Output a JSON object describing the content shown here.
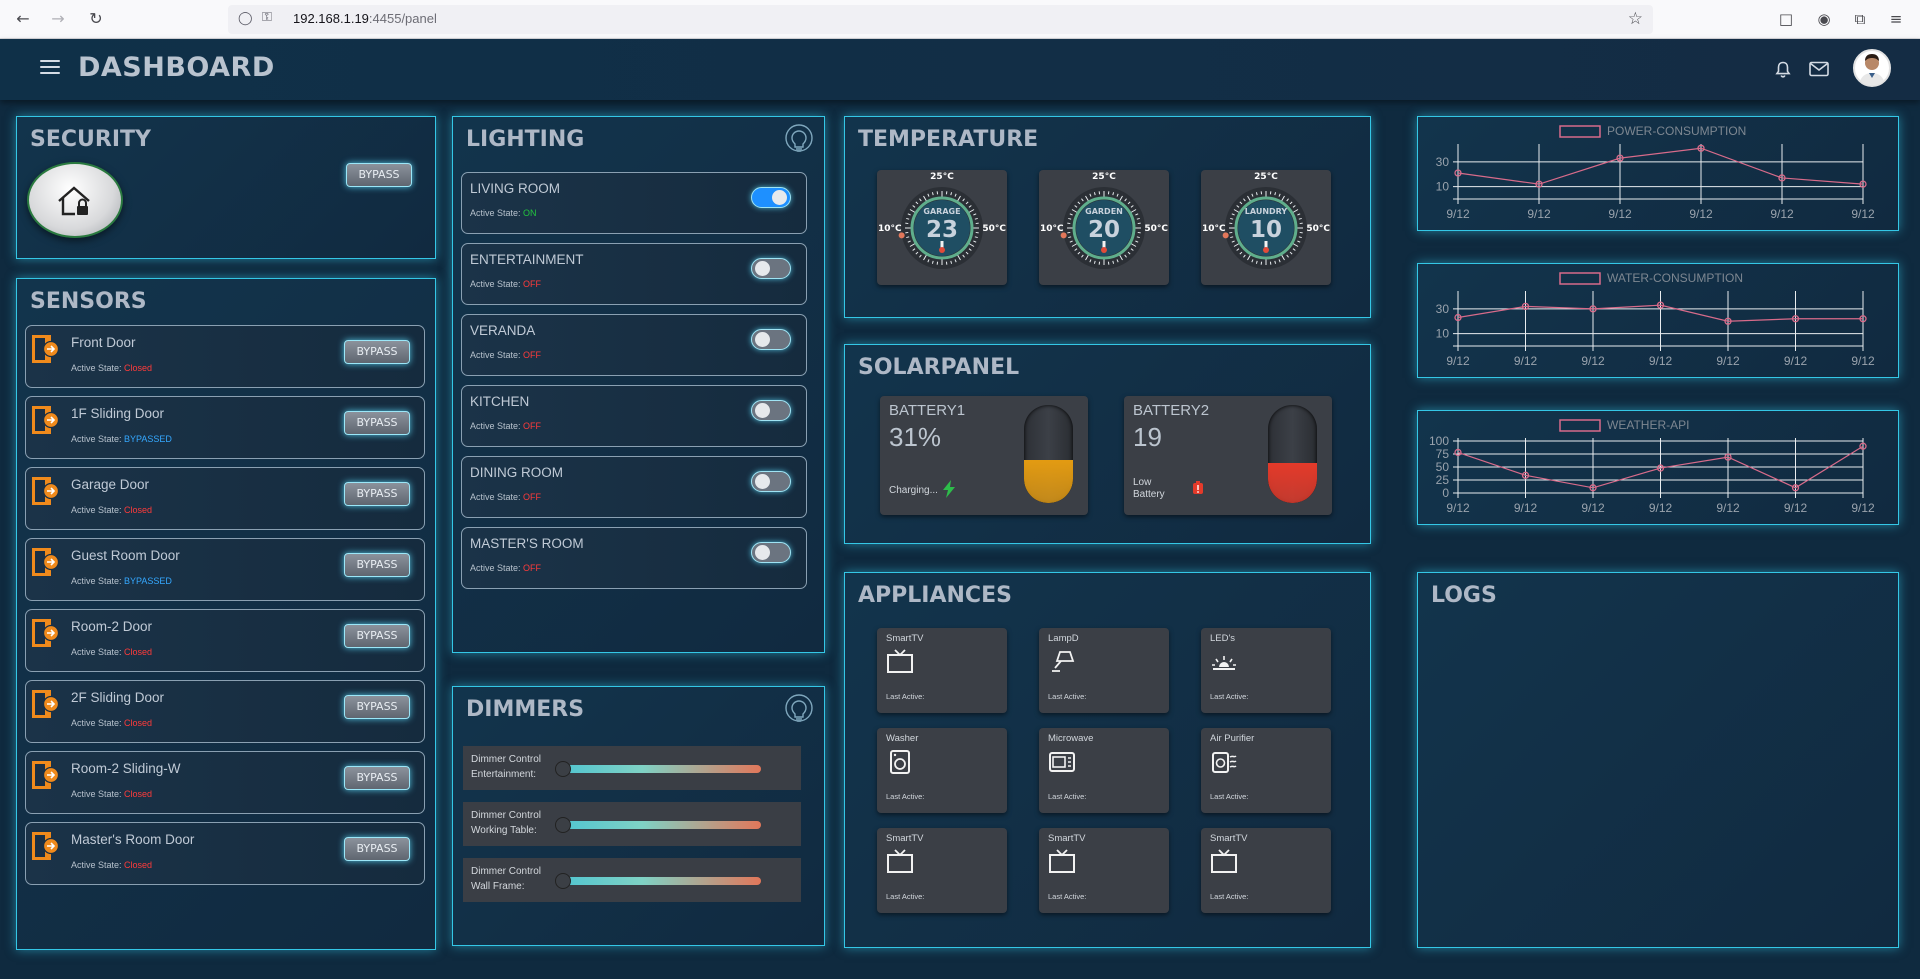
{
  "browser": {
    "url_host": "192.168.1.19",
    "url_rest": ":4455/panel"
  },
  "header": {
    "title": "DASHBOARD"
  },
  "security": {
    "title": "SECURITY",
    "bypass_label": "BYPASS"
  },
  "sensors": {
    "title": "SENSORS",
    "state_prefix": "Active State:",
    "bypass_label": "BYPASS",
    "items": [
      {
        "name": "Front Door",
        "state": "Closed",
        "state_color": "#ff3b3b"
      },
      {
        "name": "1F Sliding Door",
        "state": "BYPASSED",
        "state_color": "#35a8ff"
      },
      {
        "name": "Garage Door",
        "state": "Closed",
        "state_color": "#ff3b3b"
      },
      {
        "name": "Guest Room Door",
        "state": "BYPASSED",
        "state_color": "#35a8ff"
      },
      {
        "name": "Room-2 Door",
        "state": "Closed",
        "state_color": "#ff3b3b"
      },
      {
        "name": "2F Sliding Door",
        "state": "Closed",
        "state_color": "#ff3b3b"
      },
      {
        "name": "Room-2 Sliding-W",
        "state": "Closed",
        "state_color": "#ff3b3b"
      },
      {
        "name": "Master's Room Door",
        "state": "Closed",
        "state_color": "#ff3b3b"
      }
    ]
  },
  "lighting": {
    "title": "LIGHTING",
    "icon": "light-bulb-icon",
    "state_prefix": "Active State:",
    "items": [
      {
        "name": "LIVING ROOM",
        "state": "ON",
        "on": true
      },
      {
        "name": "ENTERTAINMENT",
        "state": "OFF",
        "on": false
      },
      {
        "name": "VERANDA",
        "state": "OFF",
        "on": false
      },
      {
        "name": "KITCHEN",
        "state": "OFF",
        "on": false
      },
      {
        "name": "DINING ROOM",
        "state": "OFF",
        "on": false
      },
      {
        "name": "MASTER'S ROOM",
        "state": "OFF",
        "on": false
      }
    ]
  },
  "dimmers": {
    "title": "DIMMERS",
    "items": [
      {
        "line1": "Dimmer Control",
        "line2": "Entertainment:",
        "level": 0
      },
      {
        "line1": "Dimmer Control",
        "line2": "Working Table:",
        "level": 0
      },
      {
        "line1": "Dimmer Control",
        "line2": "Wall Frame:",
        "level": 0
      }
    ]
  },
  "temperature": {
    "title": "TEMPERATURE",
    "top_label": "25°C",
    "min_label": "10°C",
    "max_label": "50°C",
    "items": [
      {
        "name": "GARAGE",
        "value": "23"
      },
      {
        "name": "GARDEN",
        "value": "20"
      },
      {
        "name": "LAUNDRY",
        "value": "10"
      }
    ]
  },
  "solarpanel": {
    "title": "SOLARPANEL",
    "batteries": [
      {
        "name": "BATTERY1",
        "value": "31%",
        "status_line1": "Charging...",
        "status_line2": "",
        "level": 0.31,
        "fill_color": "#e39b12"
      },
      {
        "name": "BATTERY2",
        "value": "19",
        "status_line1": "Low",
        "status_line2": "Battery",
        "level": 0.19,
        "fill_color": "#e43a2a"
      }
    ]
  },
  "appliances": {
    "title": "APPLIANCES",
    "last_active_label": "Last Active:",
    "items": [
      {
        "name": "SmartTV",
        "icon": "tv-icon"
      },
      {
        "name": "LampD",
        "icon": "desk-lamp-icon"
      },
      {
        "name": "LED's",
        "icon": "led-light-icon"
      },
      {
        "name": "Washer",
        "icon": "washing-machine-icon"
      },
      {
        "name": "Microwave",
        "icon": "microwave-icon"
      },
      {
        "name": "Air Purifier",
        "icon": "air-purifier-icon"
      },
      {
        "name": "SmartTV",
        "icon": "tv-icon"
      },
      {
        "name": "SmartTV",
        "icon": "tv-icon"
      },
      {
        "name": "SmartTV",
        "icon": "tv-icon"
      }
    ]
  },
  "logs": {
    "title": "LOGS"
  },
  "chart_data": [
    {
      "type": "line",
      "title": "POWER-CONSUMPTION",
      "categories": [
        "9/12",
        "9/12",
        "9/12",
        "9/12",
        "9/12",
        "9/12"
      ],
      "yticks": [
        10,
        30
      ],
      "ylim": [
        0,
        42
      ],
      "series": [
        {
          "name": "POWER-CONSUMPTION",
          "values": [
            21,
            12,
            33,
            41,
            17,
            12
          ]
        }
      ],
      "color": "#d86b8a"
    },
    {
      "type": "line",
      "title": "WATER-CONSUMPTION",
      "categories": [
        "9/12",
        "9/12",
        "9/12",
        "9/12",
        "9/12",
        "9/12",
        "9/12"
      ],
      "yticks": [
        10,
        30
      ],
      "ylim": [
        0,
        42
      ],
      "series": [
        {
          "name": "WATER-CONSUMPTION",
          "values": [
            23,
            32,
            30,
            33,
            20,
            22,
            22
          ]
        }
      ],
      "color": "#d86b8a"
    },
    {
      "type": "line",
      "title": "WEATHER-API",
      "categories": [
        "9/12",
        "9/12",
        "9/12",
        "9/12",
        "9/12",
        "9/12",
        "9/12"
      ],
      "yticks": [
        0,
        25,
        50,
        75,
        100
      ],
      "ylim": [
        0,
        100
      ],
      "series": [
        {
          "name": "WEATHER-API",
          "values": [
            78,
            34,
            10,
            48,
            69,
            10,
            90
          ]
        }
      ],
      "color": "#d86b8a"
    }
  ]
}
